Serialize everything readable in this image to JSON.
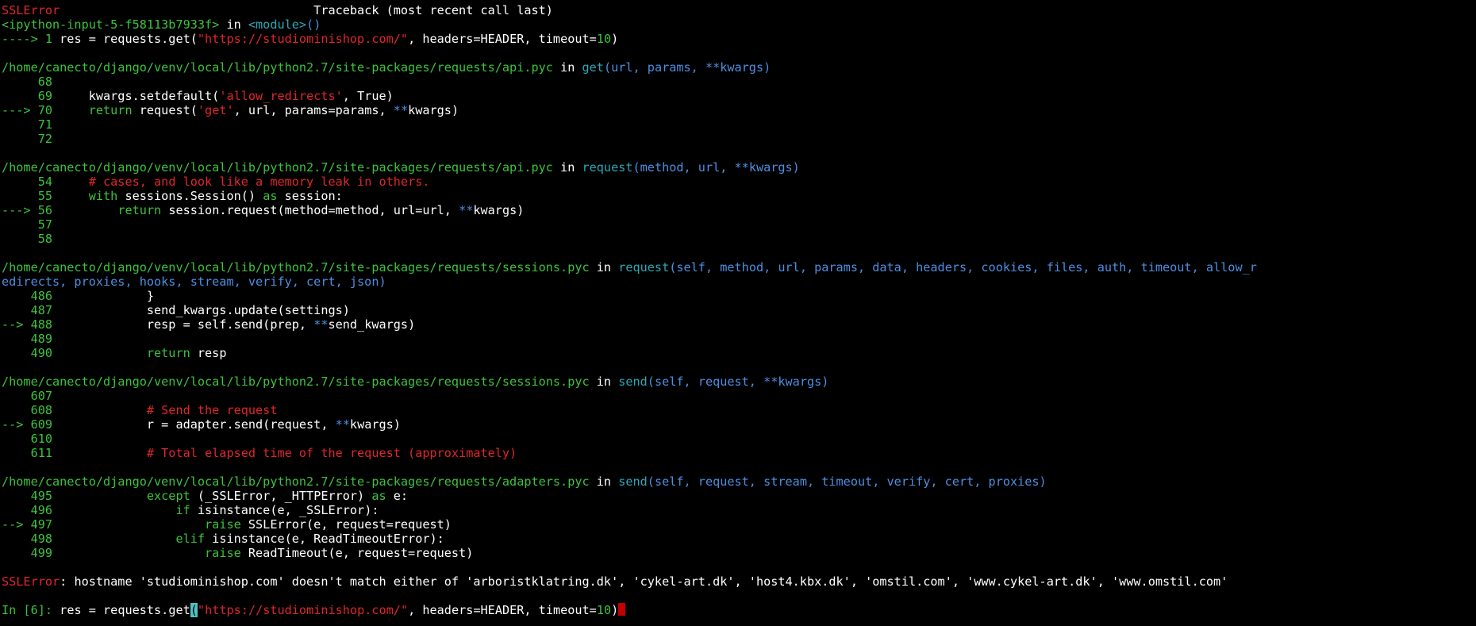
{
  "colors": {
    "background": "#000000",
    "red": "#e0262b",
    "green": "#3cc33c",
    "white": "#ffffff",
    "cyan": "#2aa8b8",
    "blue": "#4c8fe3",
    "cursor": "#4ec1c4",
    "cursor_end": "#c40000"
  },
  "terminal": {
    "lines": [
      [
        {
          "t": "SSLError",
          "c": "red"
        },
        {
          "t": "                                   Traceback (most recent call last)",
          "c": "white"
        }
      ],
      [
        {
          "t": "<ipython-input-5-f58113b7933f>",
          "c": "green"
        },
        {
          "t": " in ",
          "c": "white"
        },
        {
          "t": "<module>",
          "c": "cyan"
        },
        {
          "t": "()",
          "c": "blue"
        }
      ],
      [
        {
          "t": "----> 1 ",
          "c": "green"
        },
        {
          "t": "res = requests.get(",
          "c": "white"
        },
        {
          "t": "\"https://studiominishop.com/\"",
          "c": "red"
        },
        {
          "t": ", headers=HEADER, timeout=",
          "c": "white"
        },
        {
          "t": "10",
          "c": "green"
        },
        {
          "t": ")",
          "c": "white"
        }
      ],
      [],
      [
        {
          "t": "/home/canecto/django/venv/local/lib/python2.7/site-packages/requests/api.pyc",
          "c": "green"
        },
        {
          "t": " in ",
          "c": "white"
        },
        {
          "t": "get",
          "c": "cyan"
        },
        {
          "t": "(url, params, **kwargs)",
          "c": "blue"
        }
      ],
      [
        {
          "t": "     68",
          "c": "green"
        }
      ],
      [
        {
          "t": "     69     ",
          "c": "green"
        },
        {
          "t": "kwargs.setdefault(",
          "c": "white"
        },
        {
          "t": "'allow_redirects'",
          "c": "red"
        },
        {
          "t": ", ",
          "c": "white"
        },
        {
          "t": "True",
          "c": "white"
        },
        {
          "t": ")",
          "c": "white"
        }
      ],
      [
        {
          "t": "---> 70     ",
          "c": "green"
        },
        {
          "t": "return",
          "c": "green"
        },
        {
          "t": " request(",
          "c": "white"
        },
        {
          "t": "'get'",
          "c": "red"
        },
        {
          "t": ", url, params=params, ",
          "c": "white"
        },
        {
          "t": "**",
          "c": "blue"
        },
        {
          "t": "kwargs)",
          "c": "white"
        }
      ],
      [
        {
          "t": "     71",
          "c": "green"
        }
      ],
      [
        {
          "t": "     72",
          "c": "green"
        }
      ],
      [],
      [
        {
          "t": "/home/canecto/django/venv/local/lib/python2.7/site-packages/requests/api.pyc",
          "c": "green"
        },
        {
          "t": " in ",
          "c": "white"
        },
        {
          "t": "request",
          "c": "cyan"
        },
        {
          "t": "(method, url, **kwargs)",
          "c": "blue"
        }
      ],
      [
        {
          "t": "     54     ",
          "c": "green"
        },
        {
          "t": "# cases, and look like a memory leak in others.",
          "c": "red"
        }
      ],
      [
        {
          "t": "     55     ",
          "c": "green"
        },
        {
          "t": "with",
          "c": "green"
        },
        {
          "t": " sessions.Session() ",
          "c": "white"
        },
        {
          "t": "as",
          "c": "green"
        },
        {
          "t": " session:",
          "c": "white"
        }
      ],
      [
        {
          "t": "---> 56         ",
          "c": "green"
        },
        {
          "t": "return",
          "c": "green"
        },
        {
          "t": " session.request(method=method, url=url, ",
          "c": "white"
        },
        {
          "t": "**",
          "c": "blue"
        },
        {
          "t": "kwargs)",
          "c": "white"
        }
      ],
      [
        {
          "t": "     57",
          "c": "green"
        }
      ],
      [
        {
          "t": "     58",
          "c": "green"
        }
      ],
      [],
      [
        {
          "t": "/home/canecto/django/venv/local/lib/python2.7/site-packages/requests/sessions.pyc",
          "c": "green"
        },
        {
          "t": " in ",
          "c": "white"
        },
        {
          "t": "request",
          "c": "cyan"
        },
        {
          "t": "(self, method, url, params, data, headers, cookies, files, auth, timeout, allow_r",
          "c": "blue"
        }
      ],
      [
        {
          "t": "edirects, proxies, hooks, stream, verify, cert, json)",
          "c": "blue"
        }
      ],
      [
        {
          "t": "    486             ",
          "c": "green"
        },
        {
          "t": "}",
          "c": "white"
        }
      ],
      [
        {
          "t": "    487             ",
          "c": "green"
        },
        {
          "t": "send_kwargs.update(settings)",
          "c": "white"
        }
      ],
      [
        {
          "t": "--> 488             ",
          "c": "green"
        },
        {
          "t": "resp = self.send(prep, ",
          "c": "white"
        },
        {
          "t": "**",
          "c": "blue"
        },
        {
          "t": "send_kwargs)",
          "c": "white"
        }
      ],
      [
        {
          "t": "    489",
          "c": "green"
        }
      ],
      [
        {
          "t": "    490             ",
          "c": "green"
        },
        {
          "t": "return",
          "c": "green"
        },
        {
          "t": " resp",
          "c": "white"
        }
      ],
      [],
      [
        {
          "t": "/home/canecto/django/venv/local/lib/python2.7/site-packages/requests/sessions.pyc",
          "c": "green"
        },
        {
          "t": " in ",
          "c": "white"
        },
        {
          "t": "send",
          "c": "cyan"
        },
        {
          "t": "(self, request, **kwargs)",
          "c": "blue"
        }
      ],
      [
        {
          "t": "    607",
          "c": "green"
        }
      ],
      [
        {
          "t": "    608             ",
          "c": "green"
        },
        {
          "t": "# Send the request",
          "c": "red"
        }
      ],
      [
        {
          "t": "--> 609             ",
          "c": "green"
        },
        {
          "t": "r = adapter.send(request, ",
          "c": "white"
        },
        {
          "t": "**",
          "c": "blue"
        },
        {
          "t": "kwargs)",
          "c": "white"
        }
      ],
      [
        {
          "t": "    610",
          "c": "green"
        }
      ],
      [
        {
          "t": "    611             ",
          "c": "green"
        },
        {
          "t": "# Total elapsed time of the request (approximately)",
          "c": "red"
        }
      ],
      [],
      [
        {
          "t": "/home/canecto/django/venv/local/lib/python2.7/site-packages/requests/adapters.pyc",
          "c": "green"
        },
        {
          "t": " in ",
          "c": "white"
        },
        {
          "t": "send",
          "c": "cyan"
        },
        {
          "t": "(self, request, stream, timeout, verify, cert, proxies)",
          "c": "blue"
        }
      ],
      [
        {
          "t": "    495             ",
          "c": "green"
        },
        {
          "t": "except",
          "c": "green"
        },
        {
          "t": " (_SSLError, _HTTPError) ",
          "c": "white"
        },
        {
          "t": "as",
          "c": "green"
        },
        {
          "t": " e:",
          "c": "white"
        }
      ],
      [
        {
          "t": "    496                 ",
          "c": "green"
        },
        {
          "t": "if",
          "c": "green"
        },
        {
          "t": " isinstance(e, _SSLError):",
          "c": "white"
        }
      ],
      [
        {
          "t": "--> 497                     ",
          "c": "green"
        },
        {
          "t": "raise",
          "c": "green"
        },
        {
          "t": " SSLError(e, request=request)",
          "c": "white"
        }
      ],
      [
        {
          "t": "    498                 ",
          "c": "green"
        },
        {
          "t": "elif",
          "c": "green"
        },
        {
          "t": " isinstance(e, ReadTimeoutError):",
          "c": "white"
        }
      ],
      [
        {
          "t": "    499                     ",
          "c": "green"
        },
        {
          "t": "raise",
          "c": "green"
        },
        {
          "t": " ReadTimeout(e, request=request)",
          "c": "white"
        }
      ],
      [],
      [
        {
          "t": "SSLError",
          "c": "red"
        },
        {
          "t": ": hostname 'studiominishop.com' doesn't match either of 'arboristklatring.dk', 'cykel-art.dk', 'host4.kbx.dk', 'omstil.com', 'www.cykel-art.dk', 'www.omstil.com'",
          "c": "white"
        }
      ],
      [],
      [
        {
          "t": "In [",
          "c": "green"
        },
        {
          "t": "6",
          "c": "green"
        },
        {
          "t": "]: ",
          "c": "green"
        },
        {
          "t": "res = requests.get",
          "c": "white"
        },
        {
          "t": "(",
          "c": "white",
          "cursor": true
        },
        {
          "t": "\"https://studiominishop.com/\"",
          "c": "red"
        },
        {
          "t": ", headers=HEADER, timeout=",
          "c": "white"
        },
        {
          "t": "10",
          "c": "green"
        },
        {
          "t": ")",
          "c": "white"
        },
        {
          "t": "",
          "c": "white",
          "end": true
        }
      ]
    ]
  }
}
